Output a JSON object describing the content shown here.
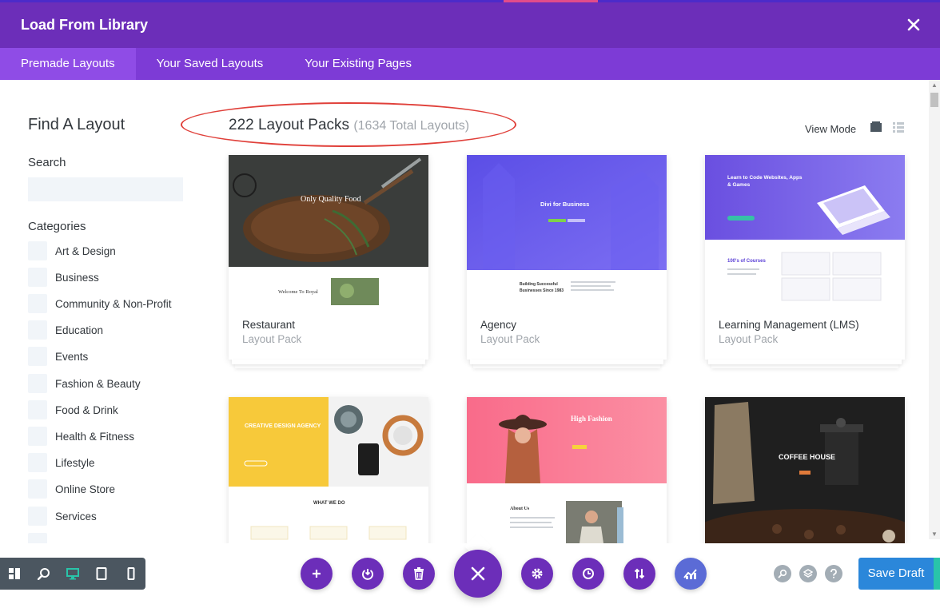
{
  "modal": {
    "title": "Load From Library",
    "tabs": [
      {
        "label": "Premade Layouts",
        "active": true
      },
      {
        "label": "Your Saved Layouts",
        "active": false
      },
      {
        "label": "Your Existing Pages",
        "active": false
      }
    ]
  },
  "sidebar": {
    "heading": "Find A Layout",
    "search_label": "Search",
    "search_value": "",
    "categories_label": "Categories",
    "categories": [
      "Art & Design",
      "Business",
      "Community & Non-Profit",
      "Education",
      "Events",
      "Fashion & Beauty",
      "Food & Drink",
      "Health & Fitness",
      "Lifestyle",
      "Online Store",
      "Services"
    ]
  },
  "main": {
    "packs_count": "222 Layout Packs",
    "total_layouts": "(1634 Total Layouts)",
    "view_mode_label": "View Mode",
    "cards": [
      {
        "name": "Restaurant",
        "sub": "Layout Pack",
        "thumb_title": "Only Quality Food",
        "thumb_sub": "Welcome To Royal"
      },
      {
        "name": "Agency",
        "sub": "Layout Pack",
        "thumb_title": "Divi for Business",
        "thumb_sub": "Building Successful Businesses Since 1983"
      },
      {
        "name": "Learning Management (LMS)",
        "sub": "Layout Pack",
        "thumb_title": "Learn to Code Websites, Apps & Games",
        "thumb_sub": "100's of Courses"
      },
      {
        "name": "",
        "sub": "",
        "thumb_title": "CREATIVE DESIGN AGENCY",
        "thumb_sub": "WHAT WE DO"
      },
      {
        "name": "",
        "sub": "",
        "thumb_title": "High Fashion",
        "thumb_sub": "About Us"
      },
      {
        "name": "",
        "sub": "",
        "thumb_title": "COFFEE HOUSE",
        "thumb_sub": ""
      }
    ]
  },
  "footer": {
    "save_label": "Save Draft"
  },
  "colors": {
    "header": "#6c2eb9",
    "tabs": "#7d3bd6",
    "tab_active": "#8f4ce6",
    "primary_button": "#2b87da",
    "highlight_ellipse": "#e0403a"
  }
}
